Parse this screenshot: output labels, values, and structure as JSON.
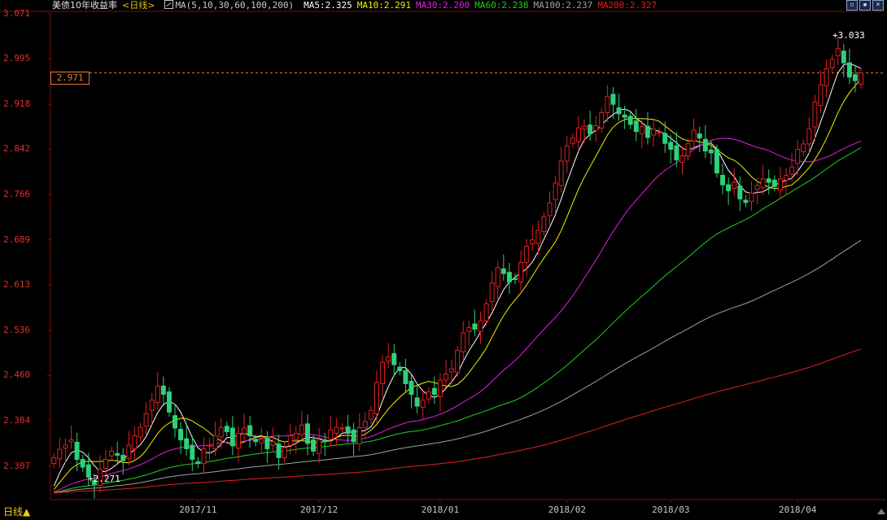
{
  "header": {
    "title": "美债10年收益率",
    "period": "<日线>",
    "ma_label": "MA(5,10,30,60,100,200)",
    "ma_values": [
      {
        "label": "MA5:2.325",
        "color": "#ffffff"
      },
      {
        "label": "MA10:2.291",
        "color": "#f0f000"
      },
      {
        "label": "MA30:2.200",
        "color": "#e020e0"
      },
      {
        "label": "MA60:2.238",
        "color": "#20d020"
      },
      {
        "label": "MA100:2.237",
        "color": "#a0a0a0"
      },
      {
        "label": "MA200:2.327",
        "color": "#e02020"
      }
    ]
  },
  "current_value": "2.971",
  "annotations": {
    "high": "3.033",
    "low": "2.271"
  },
  "period_button": "日线▲",
  "window_controls": [
    "▫",
    "▪",
    "×"
  ],
  "chart_data": {
    "type": "candlestick",
    "ylim": [
      2.25,
      3.075
    ],
    "y_ticks": [
      "3.071",
      "2.995",
      "2.918",
      "2.842",
      "2.766",
      "2.689",
      "2.613",
      "2.536",
      "2.460",
      "2.384",
      "2.307"
    ],
    "x_ticks": [
      {
        "label": "2017/11",
        "index": 25
      },
      {
        "label": "2017/12",
        "index": 46
      },
      {
        "label": "2018/01",
        "index": 67
      },
      {
        "label": "2018/02",
        "index": 89
      },
      {
        "label": "2018/03",
        "index": 107
      },
      {
        "label": "2018/04",
        "index": 129
      }
    ],
    "closes": [
      2.321,
      2.335,
      2.342,
      2.351,
      2.318,
      2.305,
      2.288,
      2.276,
      2.301,
      2.318,
      2.332,
      2.325,
      2.316,
      2.342,
      2.358,
      2.372,
      2.395,
      2.418,
      2.442,
      2.428,
      2.398,
      2.371,
      2.351,
      2.336,
      2.318,
      2.311,
      2.336,
      2.342,
      2.358,
      2.372,
      2.365,
      2.341,
      2.362,
      2.371,
      2.358,
      2.348,
      2.352,
      2.336,
      2.348,
      2.321,
      2.338,
      2.358,
      2.362,
      2.376,
      2.345,
      2.332,
      2.351,
      2.348,
      2.368,
      2.372,
      2.371,
      2.362,
      2.348,
      2.372,
      2.382,
      2.401,
      2.448,
      2.482,
      2.491,
      2.478,
      2.468,
      2.446,
      2.428,
      2.408,
      2.418,
      2.432,
      2.428,
      2.452,
      2.462,
      2.471,
      2.502,
      2.532,
      2.541,
      2.538,
      2.552,
      2.581,
      2.616,
      2.642,
      2.632,
      2.618,
      2.622,
      2.651,
      2.678,
      2.689,
      2.705,
      2.728,
      2.751,
      2.785,
      2.822,
      2.848,
      2.861,
      2.878,
      2.881,
      2.868,
      2.882,
      2.904,
      2.931,
      2.918,
      2.902,
      2.896,
      2.884,
      2.872,
      2.881,
      2.862,
      2.876,
      2.871,
      2.852,
      2.842,
      2.824,
      2.831,
      2.852,
      2.874,
      2.861,
      2.839,
      2.836,
      2.802,
      2.782,
      2.772,
      2.786,
      2.758,
      2.752,
      2.768,
      2.781,
      2.792,
      2.786,
      2.779,
      2.792,
      2.798,
      2.812,
      2.842,
      2.851,
      2.876,
      2.922,
      2.951,
      2.978,
      2.994,
      3.012,
      2.988,
      2.964,
      2.958,
      2.971
    ],
    "series": [
      {
        "name": "MA5",
        "color": "#ffffff"
      },
      {
        "name": "MA10",
        "color": "#f0f000"
      },
      {
        "name": "MA30",
        "color": "#e020e0"
      },
      {
        "name": "MA60",
        "color": "#20d020"
      },
      {
        "name": "MA100",
        "color": "#a0a0a0"
      },
      {
        "name": "MA200",
        "color": "#e02020"
      }
    ]
  },
  "colors": {
    "up": "#e02020",
    "down": "#2ed07a",
    "grid": "#7a1010",
    "current_line": "#e07a3a"
  }
}
